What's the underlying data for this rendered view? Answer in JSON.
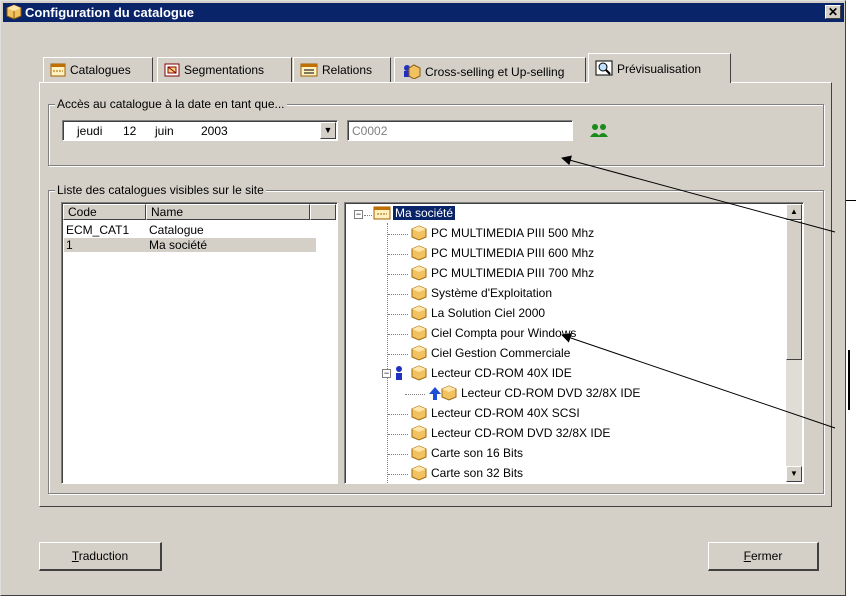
{
  "window": {
    "title": "Configuration du catalogue",
    "close_label": "✕"
  },
  "tabs": [
    {
      "label": "Catalogues",
      "icon": "catalog-icon"
    },
    {
      "label": "Segmentations",
      "icon": "segmentation-icon"
    },
    {
      "label": "Relations",
      "icon": "relations-icon"
    },
    {
      "label": "Cross-selling et Up-selling",
      "icon": "cross-selling-icon"
    },
    {
      "label": "Prévisualisation",
      "icon": "preview-icon",
      "active": true
    }
  ],
  "access": {
    "legend": "Accès au catalogue à la date en tant que...",
    "date": {
      "day_name": "jeudi",
      "day": "12",
      "month": "juin",
      "year": "2003"
    },
    "customer_code": "C0002",
    "users_icon": "users-icon"
  },
  "catalog_list": {
    "legend": "Liste des catalogues visibles sur le site",
    "columns": [
      "Code",
      "Name"
    ],
    "rows": [
      {
        "code": "ECM_CAT1",
        "name": "Catalogue"
      },
      {
        "code": "1",
        "name": "Ma société",
        "selected": true
      }
    ]
  },
  "tree": {
    "root": "Ma société",
    "items": [
      "PC MULTIMEDIA PIII 500 Mhz",
      "PC MULTIMEDIA PIII 600 Mhz",
      "PC MULTIMEDIA PIII 700 Mhz",
      "Système d'Exploitation",
      "La Solution Ciel 2000",
      "Ciel Compta pour Windows",
      "Ciel Gestion Commerciale",
      "Lecteur CD-ROM 40X IDE",
      "Lecteur CD-ROM DVD 32/8X IDE",
      "Lecteur CD-ROM 40X SCSI",
      "Lecteur CD-ROM DVD 32/8X IDE",
      "Carte son 16 Bits",
      "Carte son 32 Bits"
    ]
  },
  "buttons": {
    "translate_label_u": "T",
    "translate_label_rest": "raduction",
    "close_label_u": "F",
    "close_label_rest": "ermer"
  }
}
